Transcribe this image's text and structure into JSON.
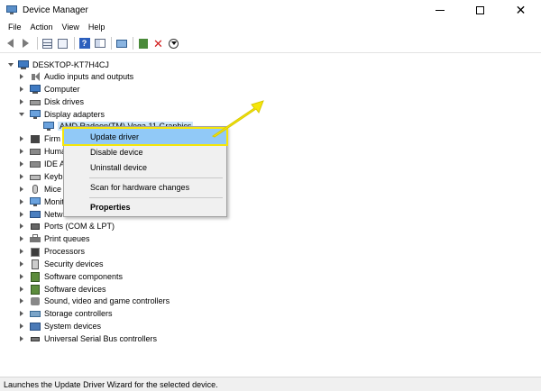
{
  "window": {
    "title": "Device Manager",
    "controls": {
      "minimize": "—",
      "maximize": "□",
      "close": "✕"
    }
  },
  "menubar": [
    "File",
    "Action",
    "View",
    "Help"
  ],
  "toolbar": {
    "icons": [
      "back-icon",
      "forward-icon",
      "device-list-icon",
      "properties-icon",
      "help-icon",
      "panel-icon",
      "monitor-icon",
      "add-driver-icon",
      "uninstall-icon",
      "download-icon"
    ]
  },
  "tree": {
    "root": "DESKTOP-KT7H4CJ",
    "categories": [
      {
        "label": "Audio inputs and outputs",
        "icon": "audio-icon",
        "expanded": false
      },
      {
        "label": "Computer",
        "icon": "computer-icon",
        "expanded": false
      },
      {
        "label": "Disk drives",
        "icon": "disk-drive-icon",
        "expanded": false
      },
      {
        "label": "Display adapters",
        "icon": "display-adapter-icon",
        "expanded": true,
        "children": [
          {
            "label": "AMD Radeon(TM) Vega 11 Graphics",
            "icon": "display-adapter-icon",
            "selected": true
          }
        ]
      },
      {
        "label": "Firmware",
        "icon": "firmware-icon",
        "expanded": false
      },
      {
        "label": "Human Interface Devices",
        "icon": "hid-icon",
        "expanded": false
      },
      {
        "label": "IDE ATA/ATAPI controllers",
        "icon": "ide-icon",
        "expanded": false
      },
      {
        "label": "Keyboards",
        "icon": "keyboard-icon",
        "expanded": false
      },
      {
        "label": "Mice and other pointing devices",
        "icon": "mouse-icon",
        "expanded": false
      },
      {
        "label": "Monitors",
        "icon": "monitor-icon",
        "expanded": false
      },
      {
        "label": "Network adapters",
        "icon": "network-icon",
        "expanded": false
      },
      {
        "label": "Ports (COM & LPT)",
        "icon": "port-icon",
        "expanded": false
      },
      {
        "label": "Print queues",
        "icon": "printer-icon",
        "expanded": false
      },
      {
        "label": "Processors",
        "icon": "processor-icon",
        "expanded": false
      },
      {
        "label": "Security devices",
        "icon": "security-icon",
        "expanded": false
      },
      {
        "label": "Software components",
        "icon": "software-icon",
        "expanded": false
      },
      {
        "label": "Software devices",
        "icon": "software-icon",
        "expanded": false
      },
      {
        "label": "Sound, video and game controllers",
        "icon": "sound-icon",
        "expanded": false
      },
      {
        "label": "Storage controllers",
        "icon": "storage-icon",
        "expanded": false
      },
      {
        "label": "System devices",
        "icon": "system-icon",
        "expanded": false
      },
      {
        "label": "Universal Serial Bus controllers",
        "icon": "usb-icon",
        "expanded": false
      }
    ],
    "visible_truncated": {
      "firmware": "Firm",
      "hid": "Huma",
      "ide": "IDE A",
      "keyboards": "Keyb",
      "mice": "Mice",
      "monitors": "Monit",
      "network": "Netw"
    }
  },
  "context_menu": {
    "items": [
      {
        "label": "Update driver",
        "highlighted": true
      },
      {
        "label": "Disable device"
      },
      {
        "label": "Uninstall device"
      },
      {
        "label": "Scan for hardware changes"
      },
      {
        "label": "Properties",
        "bold": true
      }
    ]
  },
  "status": "Launches the Update Driver Wizard for the selected device.",
  "colors": {
    "highlight": "#91c9f7",
    "callout": "#f5e60a",
    "selection": "#cce4f7"
  }
}
